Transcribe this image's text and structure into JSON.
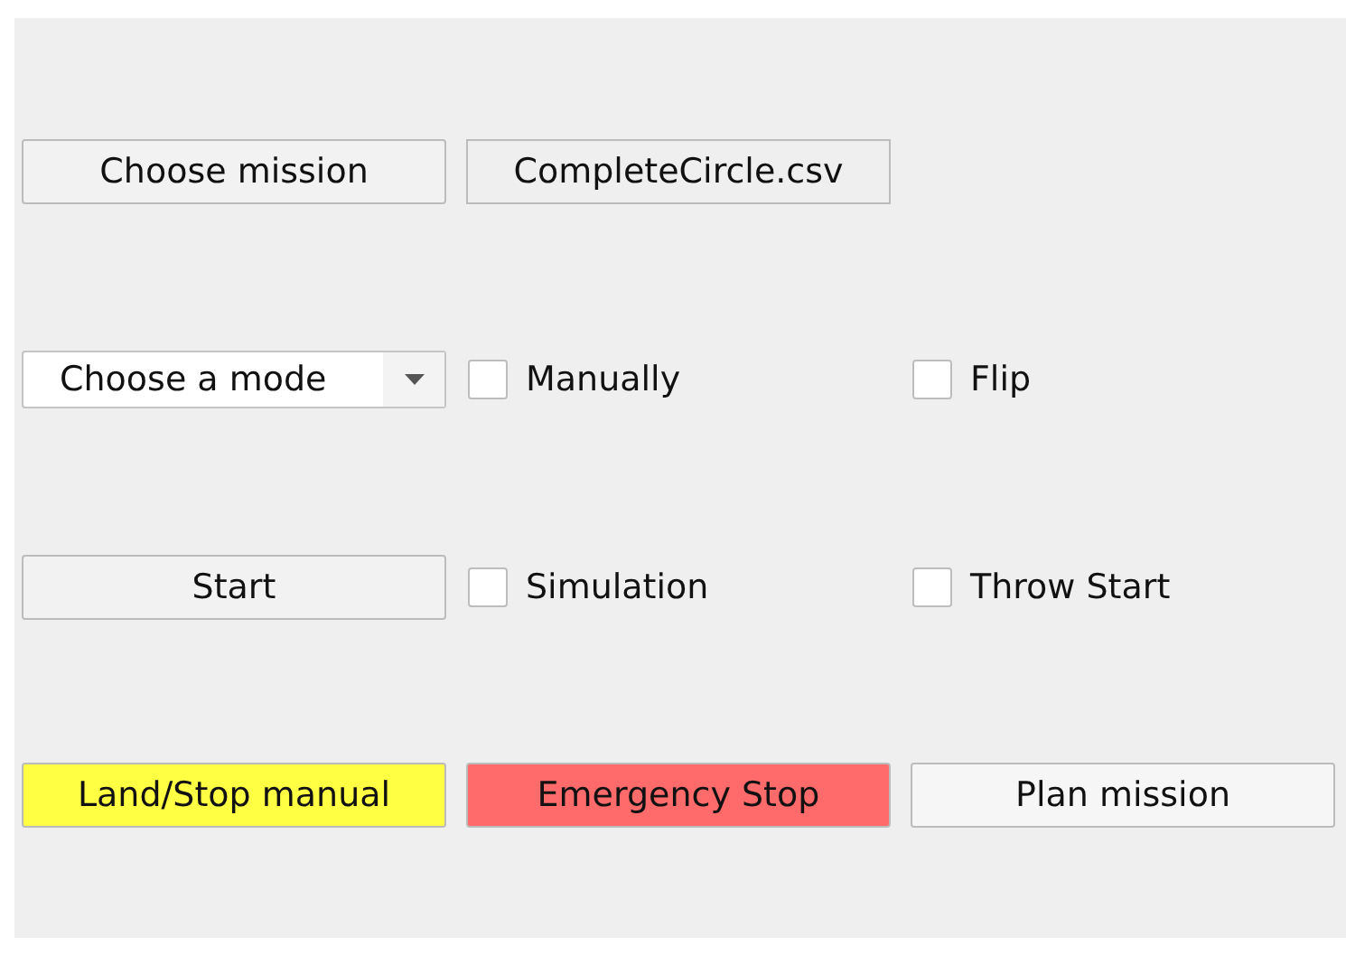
{
  "rows": [
    [
      {
        "kind": "button",
        "label": "Choose mission",
        "color": "#f2f2f2"
      },
      {
        "kind": "file",
        "label": "CompleteCircle.csv"
      }
    ],
    [
      {
        "kind": "combo",
        "value": "Choose a mode"
      },
      {
        "kind": "checkbox",
        "label": "Manually",
        "checked": false
      },
      {
        "kind": "checkbox",
        "label": "Flip",
        "checked": false
      }
    ],
    [
      {
        "kind": "button",
        "label": "Start",
        "color": "#f2f2f2"
      },
      {
        "kind": "checkbox",
        "label": "Simulation",
        "checked": false
      },
      {
        "kind": "checkbox",
        "label": "Throw Start",
        "checked": false
      }
    ],
    [
      {
        "kind": "button",
        "label": "Land/Stop manual",
        "color": "#ffff44"
      },
      {
        "kind": "button",
        "label": "Emergency Stop",
        "color": "#ff6a6a"
      },
      {
        "kind": "button",
        "label": "Plan mission",
        "color": "#f6f6f6"
      }
    ]
  ]
}
